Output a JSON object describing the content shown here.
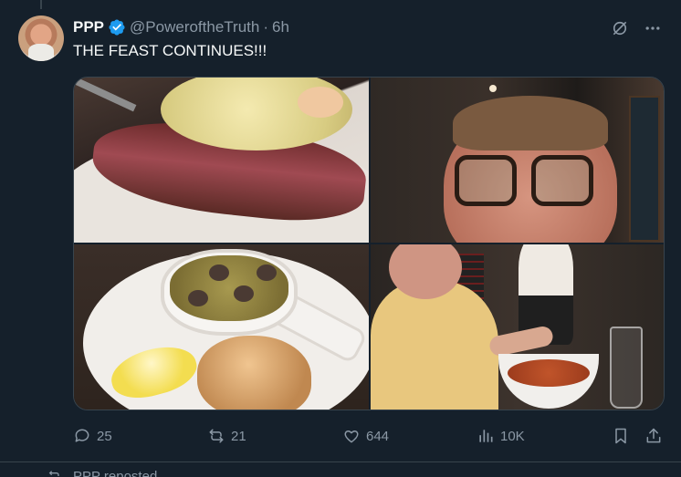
{
  "tweet": {
    "display_name": "PPP",
    "handle": "@PoweroftheTruth",
    "separator": "·",
    "time": "6h",
    "text": "THE FEAST CONTINUES!!!",
    "verified": true
  },
  "media": {
    "photos": [
      {
        "icon": "photo-steak-with-sauce"
      },
      {
        "icon": "photo-selfie-glasses"
      },
      {
        "icon": "photo-escargot-bread"
      },
      {
        "icon": "photo-man-with-soup"
      }
    ]
  },
  "actions": {
    "reply_count": "25",
    "retweet_count": "21",
    "like_count": "644",
    "views_count": "10K"
  },
  "next": {
    "text": "PPP reposted"
  },
  "colors": {
    "background": "#15202b",
    "text": "#f7f9f9",
    "muted": "#8b98a5",
    "border": "#38444d",
    "verified": "#1d9bf0"
  }
}
